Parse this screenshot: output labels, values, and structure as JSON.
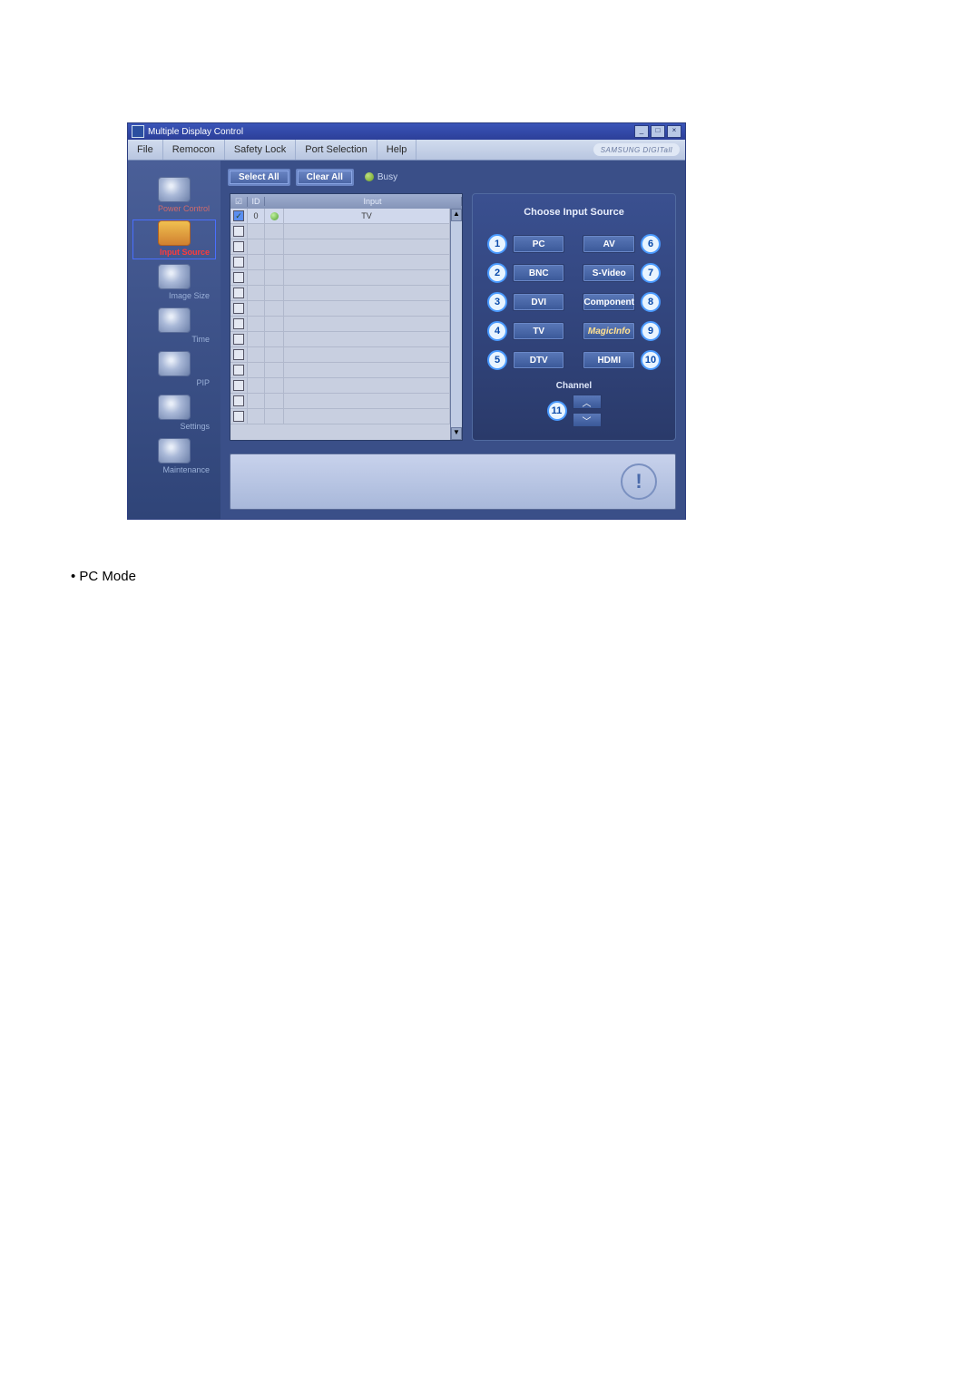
{
  "window": {
    "title": "Multiple Display Control",
    "brand": "SAMSUNG DIGITall"
  },
  "menu": {
    "file": "File",
    "remocon": "Remocon",
    "safety_lock": "Safety Lock",
    "port_selection": "Port Selection",
    "help": "Help"
  },
  "sidebar": {
    "power_control": "Power Control",
    "input_source": "Input Source",
    "image_size": "Image Size",
    "time": "Time",
    "pip": "PIP",
    "settings": "Settings",
    "maintenance": "Maintenance"
  },
  "toolbar": {
    "select_all": "Select All",
    "clear_all": "Clear All",
    "busy": "Busy"
  },
  "list": {
    "headers": {
      "id": "ID",
      "input": "Input"
    },
    "rows": [
      {
        "checked": true,
        "id": "0",
        "status": "green",
        "input": "TV"
      },
      {
        "checked": false,
        "id": "",
        "status": "",
        "input": ""
      },
      {
        "checked": false,
        "id": "",
        "status": "",
        "input": ""
      },
      {
        "checked": false,
        "id": "",
        "status": "",
        "input": ""
      },
      {
        "checked": false,
        "id": "",
        "status": "",
        "input": ""
      },
      {
        "checked": false,
        "id": "",
        "status": "",
        "input": ""
      },
      {
        "checked": false,
        "id": "",
        "status": "",
        "input": ""
      },
      {
        "checked": false,
        "id": "",
        "status": "",
        "input": ""
      },
      {
        "checked": false,
        "id": "",
        "status": "",
        "input": ""
      },
      {
        "checked": false,
        "id": "",
        "status": "",
        "input": ""
      },
      {
        "checked": false,
        "id": "",
        "status": "",
        "input": ""
      },
      {
        "checked": false,
        "id": "",
        "status": "",
        "input": ""
      },
      {
        "checked": false,
        "id": "",
        "status": "",
        "input": ""
      },
      {
        "checked": false,
        "id": "",
        "status": "",
        "input": ""
      }
    ]
  },
  "opts": {
    "title": "Choose Input Source",
    "left": [
      "PC",
      "BNC",
      "DVI",
      "TV",
      "DTV"
    ],
    "right": [
      "AV",
      "S-Video",
      "Component",
      "MagicInfo",
      "HDMI"
    ],
    "left_nums": [
      "1",
      "2",
      "3",
      "4",
      "5"
    ],
    "right_nums": [
      "6",
      "7",
      "8",
      "9",
      "10"
    ],
    "channel_label": "Channel",
    "channel_num": "11"
  },
  "footnote": "PC Mode"
}
